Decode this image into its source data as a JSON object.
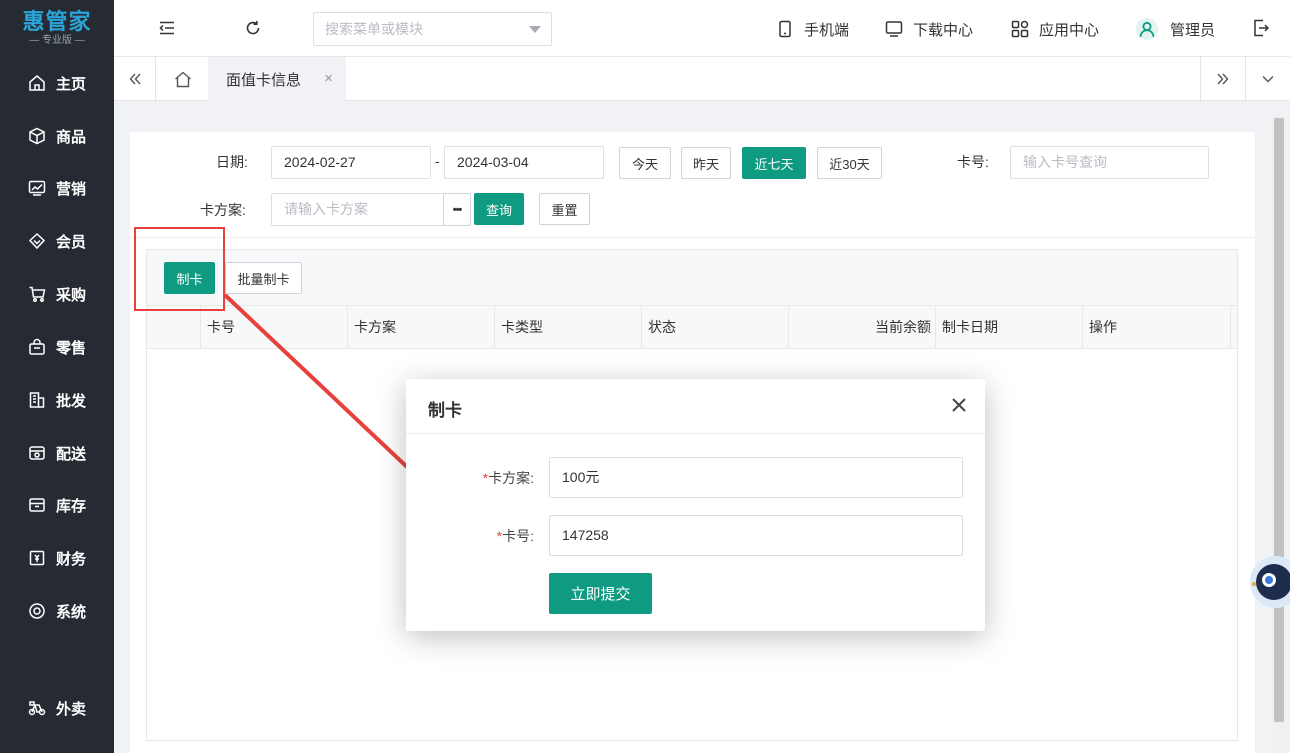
{
  "app": {
    "logo": "惠管家",
    "edition": "— 专业版 —"
  },
  "sidebar": {
    "items": [
      {
        "label": "主页",
        "icon": "home-icon"
      },
      {
        "label": "商品",
        "icon": "box-icon"
      },
      {
        "label": "营销",
        "icon": "chart-icon"
      },
      {
        "label": "会员",
        "icon": "diamond-icon"
      },
      {
        "label": "采购",
        "icon": "cart-icon"
      },
      {
        "label": "零售",
        "icon": "bag-icon"
      },
      {
        "label": "批发",
        "icon": "building-icon"
      },
      {
        "label": "配送",
        "icon": "delivery-icon"
      },
      {
        "label": "库存",
        "icon": "archive-icon"
      },
      {
        "label": "财务",
        "icon": "finance-icon"
      },
      {
        "label": "系统",
        "icon": "settings-icon"
      },
      {
        "label": "外卖",
        "icon": "bike-icon"
      }
    ]
  },
  "header": {
    "search_placeholder": "搜索菜单或模块",
    "mobile": "手机端",
    "download": "下载中心",
    "apps": "应用中心",
    "user": "管理员"
  },
  "tabs": {
    "active": "面值卡信息"
  },
  "filters": {
    "date_label": "日期:",
    "date_start": "2024-02-27",
    "date_sep": "-",
    "date_end": "2024-03-04",
    "quick": [
      "今天",
      "昨天",
      "近七天",
      "近30天"
    ],
    "card_no_label": "卡号:",
    "card_no_placeholder": "输入卡号查询",
    "plan_label": "卡方案:",
    "plan_placeholder": "请输入卡方案",
    "more": "•••",
    "query": "查询",
    "reset": "重置"
  },
  "toolbar": {
    "make_card": "制卡",
    "batch_make": "批量制卡"
  },
  "table": {
    "columns": [
      "卡号",
      "卡方案",
      "卡类型",
      "状态",
      "当前余额",
      "制卡日期",
      "操作"
    ]
  },
  "dialog": {
    "title": "制卡",
    "required_mark": "*",
    "plan_label": "卡方案:",
    "plan_value": "100元",
    "card_label": "卡号:",
    "card_value": "147258",
    "submit": "立即提交"
  },
  "colors": {
    "primary": "#0f9b82",
    "sidebar": "#262b33",
    "annotation": "#e8413c"
  }
}
